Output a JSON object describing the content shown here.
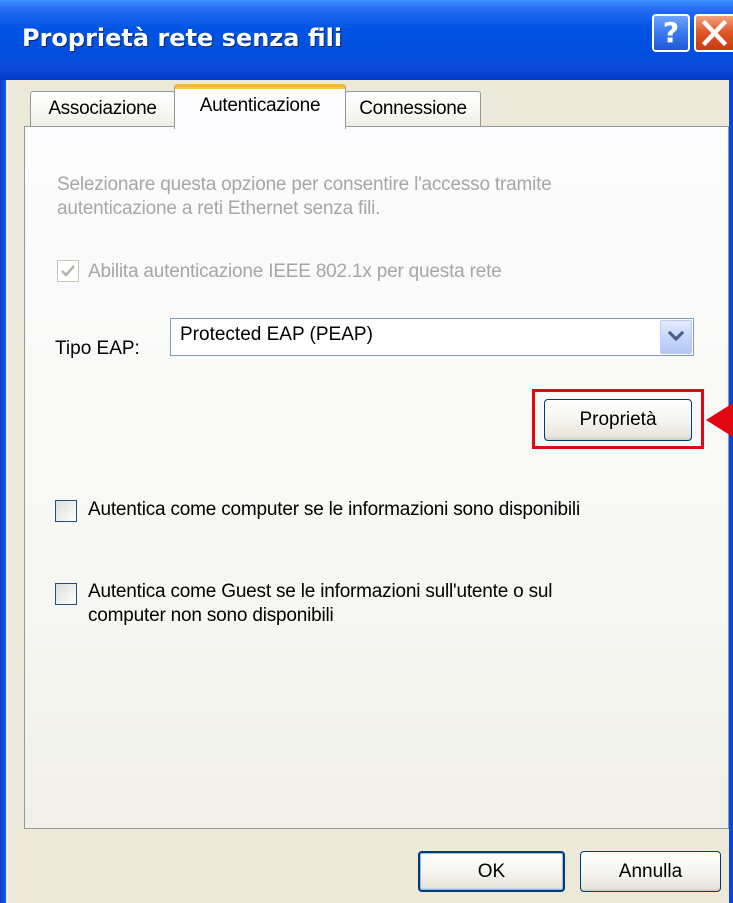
{
  "window": {
    "title": "Proprietà rete senza fili",
    "help_label": "?",
    "close_label": "X"
  },
  "tabs": [
    {
      "label": "Associazione",
      "selected": false
    },
    {
      "label": "Autenticazione",
      "selected": true
    },
    {
      "label": "Connessione",
      "selected": false
    }
  ],
  "auth": {
    "description_line1": "Selezionare questa opzione per consentire l'accesso tramite",
    "description_line2": "autenticazione a reti Ethernet senza fili.",
    "ieee_checkbox": {
      "label": "Abilita autenticazione IEEE 802.1x per questa rete",
      "checked": true,
      "disabled": true
    },
    "eap_label": "Tipo EAP:",
    "eap_selected": "Protected EAP (PEAP)",
    "properties_button": "Proprietà",
    "computer_checkbox": {
      "label": "Autentica come computer se le informazioni sono disponibili",
      "checked": false
    },
    "guest_checkbox": {
      "label_line1": "Autentica come Guest se le informazioni sull'utente o sul",
      "label_line2": "computer non sono disponibili",
      "checked": false
    }
  },
  "footer": {
    "ok_label": "OK",
    "cancel_label": "Annulla"
  },
  "annotation": {
    "highlight_color": "#e30613"
  }
}
